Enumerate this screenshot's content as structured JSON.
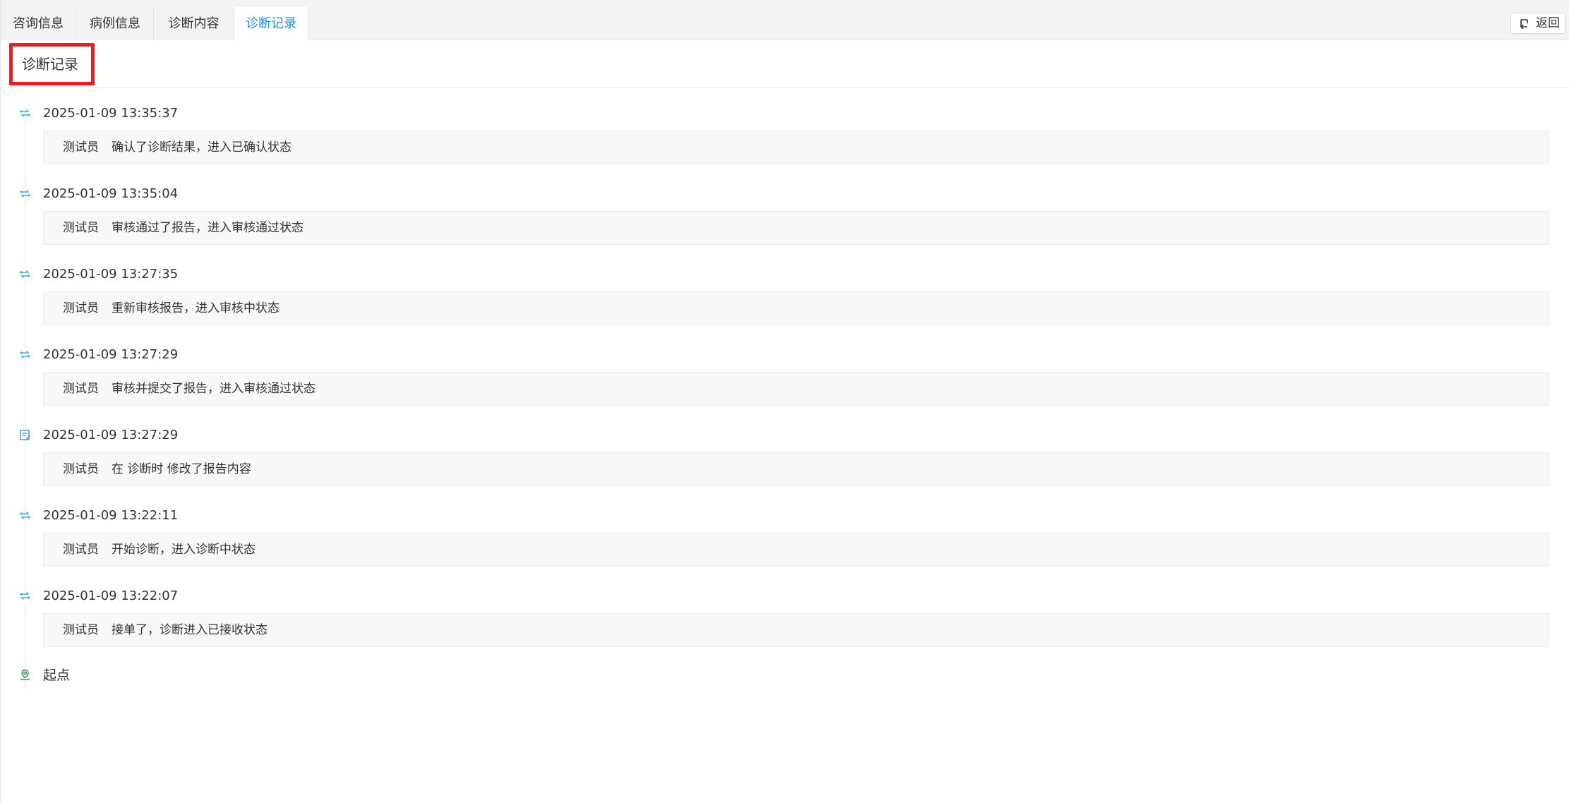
{
  "tabs": [
    {
      "label": "咨询信息",
      "active": false
    },
    {
      "label": "病例信息",
      "active": false
    },
    {
      "label": "诊断内容",
      "active": false
    },
    {
      "label": "诊断记录",
      "active": true
    }
  ],
  "back_button": {
    "label": "返回",
    "icon": "return-icon"
  },
  "section": {
    "title": "诊断记录"
  },
  "timeline": {
    "items": [
      {
        "time": "2025-01-09 13:35:37",
        "user": "测试员",
        "desc": "确认了诊断结果，进入已确认状态",
        "icon": "status-transfer-icon"
      },
      {
        "time": "2025-01-09 13:35:04",
        "user": "测试员",
        "desc": "审核通过了报告，进入审核通过状态",
        "icon": "status-transfer-icon"
      },
      {
        "time": "2025-01-09 13:27:35",
        "user": "测试员",
        "desc": "重新审核报告，进入审核中状态",
        "icon": "status-transfer-icon"
      },
      {
        "time": "2025-01-09 13:27:29",
        "user": "测试员",
        "desc": "审核并提交了报告，进入审核通过状态",
        "icon": "status-transfer-icon"
      },
      {
        "time": "2025-01-09 13:27:29",
        "user": "测试员",
        "desc": "在 诊断时 修改了报告内容",
        "icon": "edit-document-icon"
      },
      {
        "time": "2025-01-09 13:22:11",
        "user": "测试员",
        "desc": "开始诊断，进入诊断中状态",
        "icon": "status-transfer-icon"
      },
      {
        "time": "2025-01-09 13:22:07",
        "user": "测试员",
        "desc": "接单了，诊断进入已接收状态",
        "icon": "status-transfer-icon"
      }
    ],
    "end_label": "起点",
    "end_icon": "start-point-icon"
  },
  "colors": {
    "tab_active": "#1a8cf0",
    "highlight_box": "#ee1c1c",
    "transfer_icon": "#34b6d8",
    "edit_icon": "#3e8fd8",
    "start_icon": "#2f8a4a"
  }
}
